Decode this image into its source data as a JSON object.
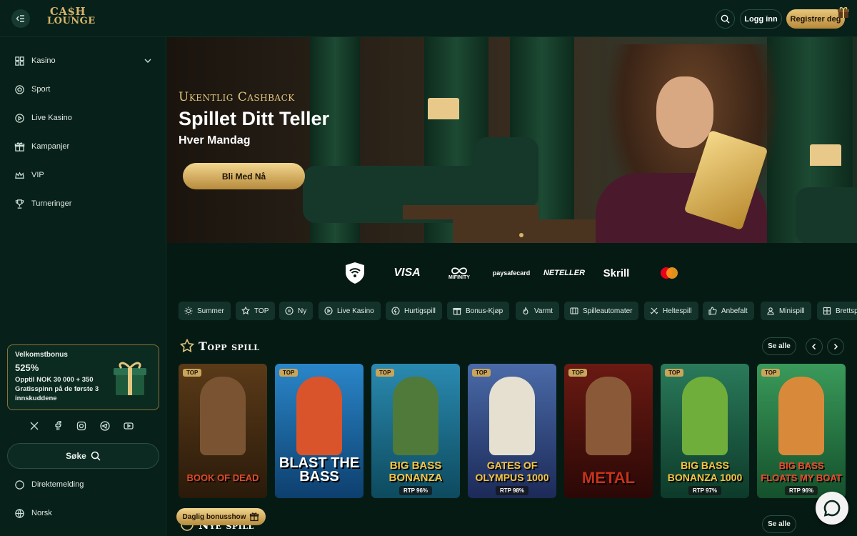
{
  "brand": {
    "logo_line1": "CA$H",
    "logo_line2": "LOUNGE",
    "accent": "#d8b46a",
    "background": "#061a14"
  },
  "header": {
    "login_label": "Logg inn",
    "register_label": "Registrer deg"
  },
  "sidebar": {
    "items": [
      {
        "label": "Kasino",
        "icon": "grid-icon"
      },
      {
        "label": "Sport",
        "icon": "ball-icon"
      },
      {
        "label": "Live Kasino",
        "icon": "play-icon"
      },
      {
        "label": "Kampanjer",
        "icon": "gift-icon"
      },
      {
        "label": "VIP",
        "icon": "crown-icon"
      },
      {
        "label": "Turneringer",
        "icon": "trophy-icon"
      }
    ],
    "bonus": {
      "title": "Velkomstbonus",
      "amount": "525%",
      "description": "Opptil NOK 30 000 + 350 Gratisspinn på de første 3 innskuddene"
    },
    "social": [
      "x-icon",
      "facebook-icon",
      "instagram-icon",
      "telegram-icon",
      "youtube-icon"
    ],
    "search_label": "Søke",
    "direct_message_label": "Direktemelding",
    "language_label": "Norsk"
  },
  "hero": {
    "subtitle": "Ukentlig Cashback",
    "title": "Spillet Ditt Teller",
    "tagline": "Hver Mandag",
    "cta_label": "Bli Med Nå"
  },
  "payments": [
    "shield-icon",
    "VISA",
    "MIFINITY",
    "paysafecard",
    "NETELLER",
    "Skrill",
    "mastercard-icon"
  ],
  "categories": [
    {
      "label": "Summer",
      "icon": "sun-icon"
    },
    {
      "label": "TOP",
      "icon": "star-icon"
    },
    {
      "label": "Ny",
      "icon": "new-icon"
    },
    {
      "label": "Live Kasino",
      "icon": "live-icon"
    },
    {
      "label": "Hurtigspill",
      "icon": "fast-icon"
    },
    {
      "label": "Bonus-Kjøp",
      "icon": "buy-icon"
    },
    {
      "label": "Varmt",
      "icon": "flame-icon"
    },
    {
      "label": "Spilleautomater",
      "icon": "slot-icon"
    },
    {
      "label": "Heltespill",
      "icon": "hero-icon"
    },
    {
      "label": "Anbefalt",
      "icon": "thumb-icon"
    },
    {
      "label": "Minispill",
      "icon": "mini-icon"
    },
    {
      "label": "Brettspill",
      "icon": "board-icon"
    }
  ],
  "top_games": {
    "title": "Topp spill",
    "see_all_label": "Se alle",
    "games": [
      {
        "name": "Book of Dead",
        "badge": "TOP",
        "rtp": ""
      },
      {
        "name": "Blast the Bass",
        "badge": "TOP",
        "rtp": ""
      },
      {
        "name": "Big Bass Bonanza",
        "badge": "TOP",
        "rtp": "RTP 96%"
      },
      {
        "name": "Gates of Olympus 1000",
        "badge": "TOP",
        "rtp": "RTP 98%"
      },
      {
        "name": "Metal",
        "badge": "TOP",
        "rtp": ""
      },
      {
        "name": "Big Bass Bonanza 1000",
        "badge": "TOP",
        "rtp": "RTP 97%"
      },
      {
        "name": "Big Bass Floats My Boat",
        "badge": "TOP",
        "rtp": "RTP 96%"
      }
    ]
  },
  "new_games": {
    "title": "Nye spill",
    "see_all_label": "Se alle"
  },
  "daily_bonus_label": "Daglig bonusshow"
}
